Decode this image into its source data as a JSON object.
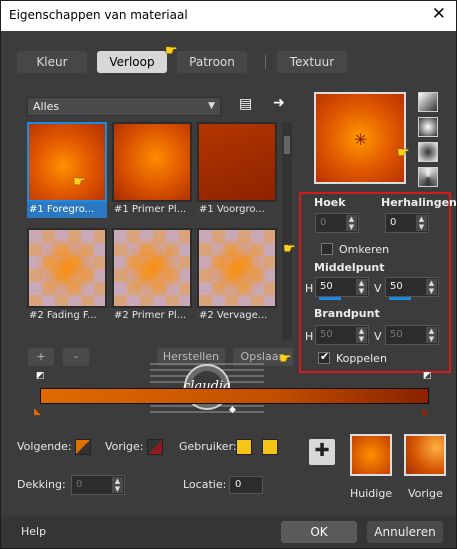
{
  "window": {
    "title": "Eigenschappen van materiaal",
    "close_glyph": "✕"
  },
  "tabs": [
    {
      "label": "Kleur",
      "active": false
    },
    {
      "label": "Verloop",
      "active": true
    },
    {
      "label": "Patroon",
      "active": false
    },
    {
      "label": "Textuur",
      "active": false
    }
  ],
  "category": {
    "selected": "Alles"
  },
  "gradients": [
    {
      "label": "#1 Foregro...",
      "selected": true
    },
    {
      "label": "#1 Primer Pl..."
    },
    {
      "label": "#1 Voorgro..."
    },
    {
      "label": "#2 Fading F..."
    },
    {
      "label": "#2 Primer Pl..."
    },
    {
      "label": "#2 Vervage..."
    }
  ],
  "buttons": {
    "add": "+",
    "remove": "-",
    "restore": "Herstellen",
    "save": "Opslaan"
  },
  "properties": {
    "angle_label": "Hoek",
    "angle_value": "0",
    "repeats_label": "Herhalingen",
    "repeats_value": "0",
    "invert_label": "Omkeren",
    "invert_checked": false,
    "center_label": "Middelpunt",
    "center_h": "50",
    "center_v": "50",
    "focal_label": "Brandpunt",
    "focal_h": "50",
    "focal_v": "50",
    "link_label": "Koppelen",
    "link_checked": true,
    "h_label": "H",
    "v_label": "V"
  },
  "bottom": {
    "next_label": "Volgende:",
    "prev_label": "Vorige:",
    "user_label": "Gebruiker:",
    "opacity_label": "Dekking:",
    "opacity_value": "0",
    "location_label": "Locatie:",
    "location_value": "0",
    "current_label": "Huidige",
    "previous_label": "Vorige"
  },
  "footer": {
    "help": "Help",
    "ok": "OK",
    "cancel": "Annuleren"
  },
  "watermark": {
    "text": "claudia"
  },
  "colors": {
    "accent": "#1e88e5",
    "highlight_box": "#d21c1c",
    "user_swatch": "#f5c518"
  }
}
